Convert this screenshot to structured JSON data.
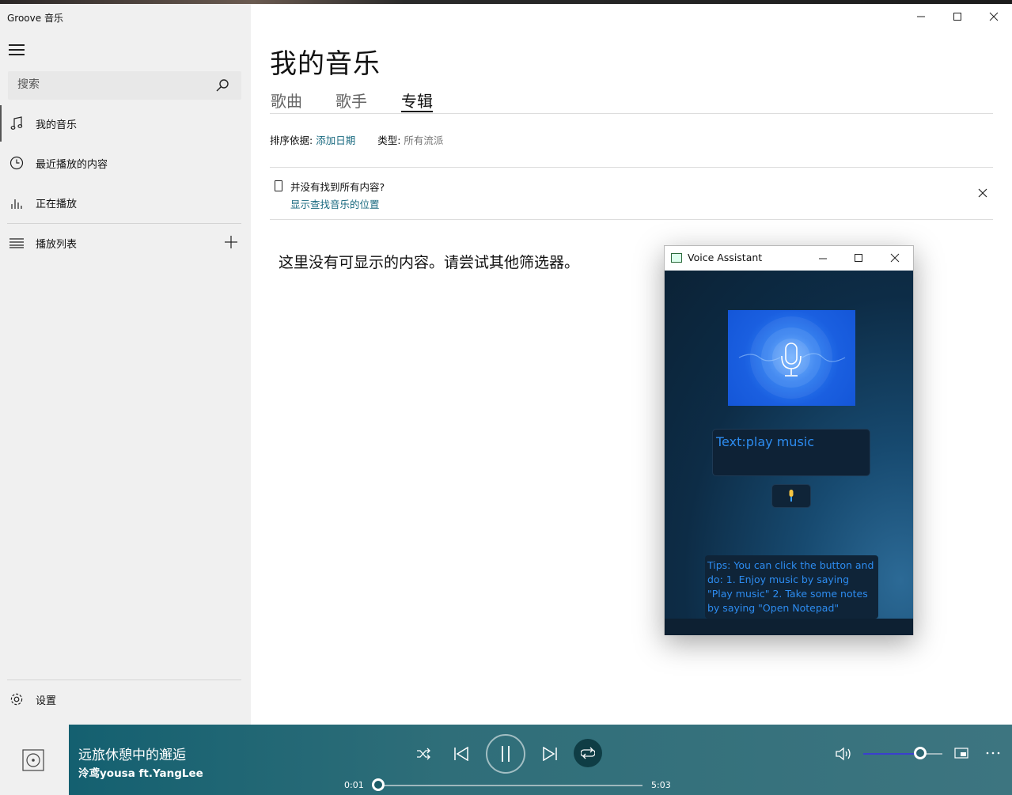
{
  "app": {
    "title": "Groove 音乐"
  },
  "sidebar": {
    "search_placeholder": "搜索",
    "items": [
      {
        "label": "我的音乐",
        "icon": "music-note-icon",
        "active": true
      },
      {
        "label": "最近播放的内容",
        "icon": "clock-icon"
      },
      {
        "label": "正在播放",
        "icon": "equalizer-icon"
      }
    ],
    "playlist_label": "播放列表",
    "settings_label": "设置"
  },
  "main": {
    "title": "我的音乐",
    "tabs": [
      {
        "label": "歌曲"
      },
      {
        "label": "歌手"
      },
      {
        "label": "专辑",
        "active": true
      }
    ],
    "sort_label": "排序依据:",
    "sort_value": "添加日期",
    "type_label": "类型:",
    "type_value": "所有流派",
    "notice_text": "并没有找到所有内容?",
    "notice_link": "显示查找音乐的位置",
    "empty_message": "这里没有可显示的内容。请尝试其他筛选器。"
  },
  "player": {
    "track_title": "远旅休憩中的邂逅",
    "track_artist": "泠鸢yousa ft.YangLee",
    "time_current": "0:01",
    "time_total": "5:03",
    "progress_fraction": 0.003,
    "volume_fraction": 0.72,
    "accent": "#3b3fcf"
  },
  "voice_assistant": {
    "title": "Voice Assistant",
    "text_display": "Text:play music",
    "tips": "Tips: You can click the button and do: 1. Enjoy music by saying \"Play music\" 2. Take some notes by saying \"Open Notepad\""
  },
  "colors": {
    "link": "#1a6a80",
    "player_bg": "#2f6e79",
    "assistant_text": "#2d8cf0"
  }
}
